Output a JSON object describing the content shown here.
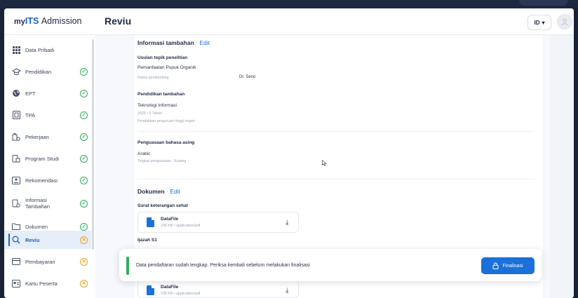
{
  "brand": {
    "my": "my",
    "its": "ITS",
    "admission": "Admission"
  },
  "header": {
    "title": "Reviu",
    "lang": "ID",
    "lang_caret": "▾"
  },
  "sidebar": {
    "items": [
      {
        "label": "Data Pribadi",
        "status": ""
      },
      {
        "label": "Pendidikan",
        "status": "done"
      },
      {
        "label": "EPT",
        "status": "done"
      },
      {
        "label": "TPA",
        "status": "done"
      },
      {
        "label": "Pekerjaan",
        "status": "done"
      },
      {
        "label": "Program Studi",
        "status": "done"
      },
      {
        "label": "Rekomendasi",
        "status": "done"
      },
      {
        "label": "Informasi Tambahan",
        "status": "done"
      },
      {
        "label": "Dokumen",
        "status": "done"
      },
      {
        "label": "Reviu",
        "status": "pending"
      },
      {
        "label": "Pembayaran",
        "status": "pending"
      },
      {
        "label": "Kartu Peserta",
        "status": "pending"
      }
    ]
  },
  "info": {
    "title": "Informasi tambahan",
    "sep": "·",
    "edit": "Edit",
    "topic_label": "Usulan topik penelitian",
    "topic_value": "Pemanfaatan Pupuk Organik",
    "supervisor_label": "Nama pembimbing",
    "supervisor_value": "Dr. Seno",
    "edu_label": "Pendidikan tambahan",
    "edu_value": "Teknologi Informasi",
    "edu_meta": "2026 • 5 Tahun",
    "edu_type": "Pendidikan perguruan tinggi negeri",
    "lang_label": "Penguasaan bahasa asing",
    "lang_value": "Arabic",
    "lang_level": "Tingkat penguasaan : Kurang"
  },
  "docs": {
    "title": "Dokumen",
    "sep": "·",
    "edit": "Edit",
    "items": [
      {
        "label": "Surat keterangan sehat",
        "file": "DataFile",
        "meta": "235 KB • application/pdf"
      },
      {
        "label": "Ijazah S1",
        "file": "DataFile",
        "meta": "235 KB • application/pdf"
      }
    ]
  },
  "toast": {
    "message": "Data pendaftaran sudah lengkap. Periksa kembali sebelum melakukan finalisasi",
    "button": "Finalisasi"
  },
  "colors": {
    "primary": "#1b70d9",
    "success": "#2fae5b",
    "warning": "#e6a42a"
  }
}
